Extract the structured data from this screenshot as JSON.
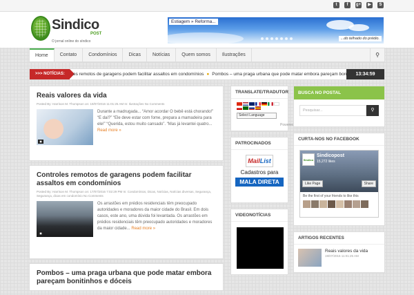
{
  "social_icons": [
    {
      "name": "twitter-icon",
      "glyph": "t"
    },
    {
      "name": "facebook-icon",
      "glyph": "f"
    },
    {
      "name": "google-plus-icon",
      "glyph": "g+"
    },
    {
      "name": "youtube-icon",
      "glyph": "▶"
    },
    {
      "name": "skype-icon",
      "glyph": "S"
    }
  ],
  "logo": {
    "name": "Sindico",
    "post": "POST",
    "tagline": "O jornal online do síndico"
  },
  "banner": {
    "left_text": "Estiagem » Reforma...",
    "right_text": "...do telhado do prédio."
  },
  "nav": {
    "items": [
      "Home",
      "Contato",
      "Condomínios",
      "Dicas",
      "Notícias",
      "Quem somos",
      "Ilustrações"
    ],
    "active": "Home",
    "search_icon": "search-icon"
  },
  "ticker": {
    "label": ">>> NOTÍCIAS:",
    "items": [
      "es remotos de garagens podem facilitar assaltos em condomínios",
      "Pombos – uma praga urbana que pode matar embora pareçam bonitinhos"
    ],
    "time": "13:34:59"
  },
  "posts": [
    {
      "title": "Reais valores da vida",
      "meta": "Posted By: Harrison M. Thompson   on: 19/07/2016 11:01:25 AM   In: Ilustrações   No Comments",
      "excerpt": "Durante a madrugada... “Amor acordar O bebê está chorando!” “E daí?” “Ele deve estar com fome, prepara a mamadeira para ele!” “Querida, estou muito cansado”. “Mas já levantei quatro...",
      "read_more": "Read more »"
    },
    {
      "title": "Controles remotos de garagens podem facilitar assaltos em condomínios",
      "meta": "Posted By: Harrison M. Thompson   on: 17/07/2016 7:02:29 PM   In: Condomínios, Dicas, Notícias, Notícias diversas, Segurança, Segurança, dicas em condomínio   No Comments",
      "excerpt": "Os arrastões em prédios residenciais têm preocupado autoridades e moradores da maior cidade do Brasil. Em dois casos, este ano, uma dúvida foi levantada. Os arrastões em prédios residenciais têm preocupado autoridades e moradores da maior cidade...",
      "read_more": "Read more »"
    },
    {
      "title": "Pombos – uma praga urbana que pode matar embora pareçam bonitinhos e dóceis"
    }
  ],
  "sidebar_mid": {
    "translate_title": "TRANSLATE/TRADUTOR",
    "language_select": "Select Language",
    "powered_by": "Powered by Google Translate",
    "sponsored_title": "PATROCINADOS",
    "mail_list_a": "Mail",
    "mail_list_b": "List",
    "cadastros": "Cadastros para",
    "mala_direta": "MALA DIRETA",
    "video_title": "VIDEONOTÍCIAS"
  },
  "sidebar_right": {
    "search_title": "BUSCA NO POSTAL",
    "search_placeholder": "Pesquisar...",
    "facebook_title": "CURTA-NOS NO FACEBOOK",
    "fb_page_name": "Sindicopost",
    "fb_likes": "15,272 likes",
    "fb_like_button": "Like Page",
    "fb_share_button": "Share",
    "fb_friends_text": "Be the first of your friends to like this",
    "recent_title": "ARTIGOS RECENTES",
    "recent_item_title": "Reais valores da vida",
    "recent_item_date": "19/07/2016 11:01:25 AM"
  },
  "colors": {
    "accent_green": "#8bc34a",
    "ticker_red": "#c62828",
    "link_orange": "#e67e22"
  }
}
